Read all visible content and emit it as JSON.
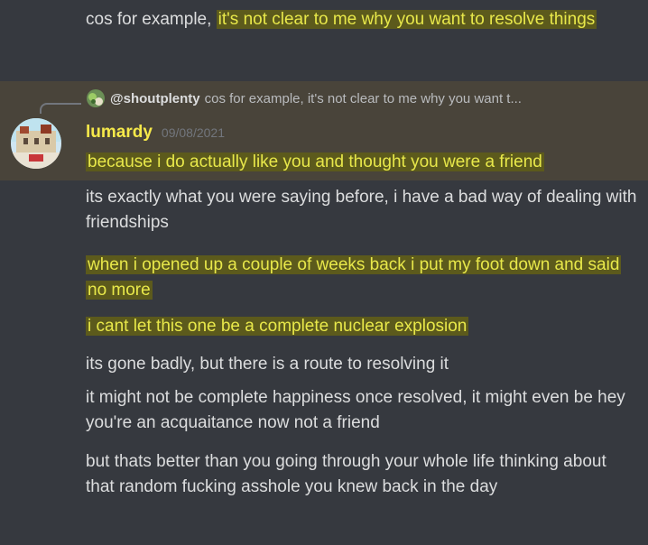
{
  "messages_above": {
    "line1_plain": "cos for example, ",
    "line1_highlight": "it's not clear to me why you want to resolve things"
  },
  "reply": {
    "avatar_icon": "cactus-avatar",
    "mention": "@shoutplenty",
    "preview": "cos for example, it's not clear to me why you want t..."
  },
  "author": {
    "name": "lumardy",
    "timestamp": "09/08/2021",
    "avatar_icon": "building-avatar"
  },
  "messages": [
    {
      "text": "because i do actually like you and thought you were a friend",
      "highlighted": true
    },
    {
      "text": "its exactly what you were saying before, i have a bad way of dealing with friendships",
      "highlighted": false
    },
    {
      "text": "when i opened up a couple of weeks back i put my foot down and said no more",
      "highlighted": true
    },
    {
      "text": "i cant let this one be a complete nuclear explosion",
      "highlighted": true
    },
    {
      "text": "its gone badly, but there is a route to resolving it",
      "highlighted": false
    },
    {
      "text": "it might not be complete happiness once resolved, it might even be hey you're an acquaitance now not a friend",
      "highlighted": false
    },
    {
      "text": "but thats better than you going through your whole life thinking about that random fucking asshole you knew back in the day",
      "highlighted": false
    }
  ],
  "colors": {
    "background": "#36393f",
    "mention_bg": "#49443a",
    "highlight_bg": "#5c5a1c",
    "highlight_text": "#e8e84a",
    "author_color": "#f6e94a"
  }
}
